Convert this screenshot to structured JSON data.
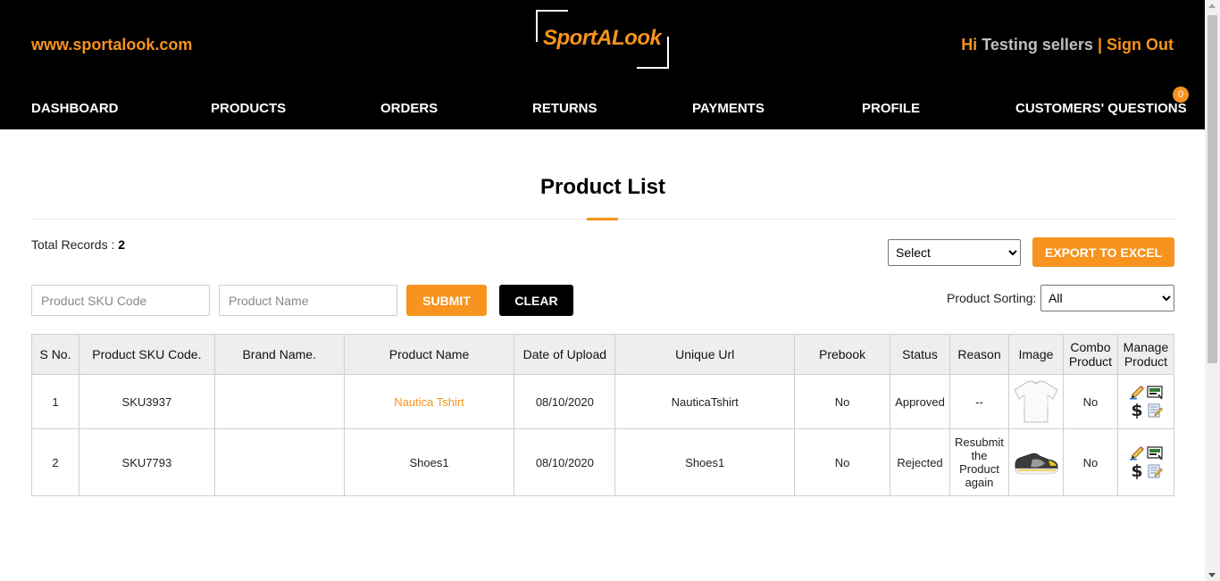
{
  "header": {
    "site_url": "www.sportalook.com",
    "logo_text": "SportALook",
    "greeting": "Hi",
    "user_name": "Testing sellers",
    "separator": "|",
    "sign_out": "Sign Out"
  },
  "nav": {
    "items": [
      "DASHBOARD",
      "PRODUCTS",
      "ORDERS",
      "RETURNS",
      "PAYMENTS",
      "PROFILE",
      "CUSTOMERS' QUESTIONS"
    ],
    "questions_badge": "0"
  },
  "page": {
    "title": "Product List",
    "total_records_label": "Total Records :",
    "total_records_value": "2"
  },
  "toolbar": {
    "export_select_value": "Select",
    "export_button": "EXPORT TO EXCEL",
    "sku_placeholder": "Product SKU Code",
    "name_placeholder": "Product Name",
    "submit_button": "SUBMIT",
    "clear_button": "CLEAR",
    "sorting_label": "Product Sorting:",
    "sorting_value": "All"
  },
  "table": {
    "headers": [
      "S No.",
      "Product SKU Code.",
      "Brand Name.",
      "Product Name",
      "Date of Upload",
      "Unique Url",
      "Prebook",
      "Status",
      "Reason",
      "Image",
      "Combo Product",
      "Manage Product"
    ],
    "rows": [
      {
        "sno": "1",
        "sku": "SKU3937",
        "brand": "",
        "name": "Nautica Tshirt",
        "date": "08/10/2020",
        "url": "NauticaTshirt",
        "prebook": "No",
        "status": "Approved",
        "reason": "--",
        "image": "tshirt-image",
        "combo": "No"
      },
      {
        "sno": "2",
        "sku": "SKU7793",
        "brand": "",
        "name": "Shoes1",
        "date": "08/10/2020",
        "url": "Shoes1",
        "prebook": "No",
        "status": "Rejected",
        "reason": "Resubmit the Product again",
        "image": "shoe-image",
        "combo": "No"
      }
    ]
  },
  "colors": {
    "accent": "#f7931e",
    "header_bg": "#000000"
  }
}
